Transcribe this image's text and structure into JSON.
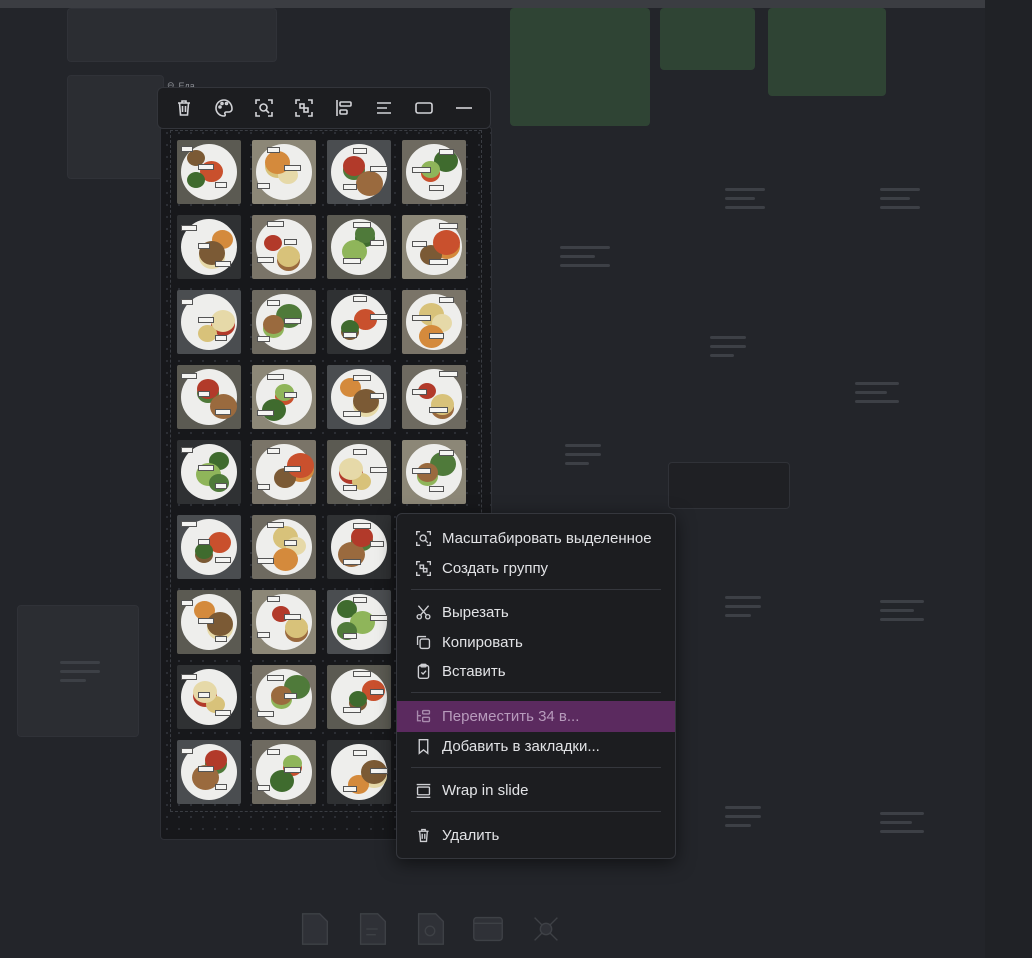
{
  "group": {
    "title": "Еда"
  },
  "toolbar": {
    "buttons": [
      {
        "name": "delete-button",
        "icon": "trash-icon"
      },
      {
        "name": "color-button",
        "icon": "palette-icon"
      },
      {
        "name": "zoom-selection-button",
        "icon": "zoom-icon"
      },
      {
        "name": "group-button",
        "icon": "group-icon"
      },
      {
        "name": "align-button",
        "icon": "align-left-icon"
      },
      {
        "name": "text-align-button",
        "icon": "text-align-icon"
      },
      {
        "name": "shape-button",
        "icon": "rectangle-icon"
      },
      {
        "name": "line-button",
        "icon": "line-icon"
      }
    ]
  },
  "tiles_count": 35,
  "context_menu": {
    "items": [
      {
        "label": "Масштабировать выделенное",
        "icon": "zoom-selection-icon"
      },
      {
        "label": "Создать группу",
        "icon": "group-icon"
      },
      {
        "label": "Вырезать",
        "icon": "scissors-icon"
      },
      {
        "label": "Копировать",
        "icon": "copy-icon"
      },
      {
        "label": "Вставить",
        "icon": "paste-icon"
      },
      {
        "label": "Переместить 34 в...",
        "icon": "move-icon",
        "highlighted": true
      },
      {
        "label": "Добавить в закладки...",
        "icon": "bookmark-icon"
      },
      {
        "label": "Wrap in slide",
        "icon": "slide-icon"
      },
      {
        "label": "Удалить",
        "icon": "trash-icon"
      }
    ]
  },
  "colors": {
    "highlight": "#5b2a5f",
    "canvas": "#23252a",
    "menu": "#1c1d20"
  }
}
